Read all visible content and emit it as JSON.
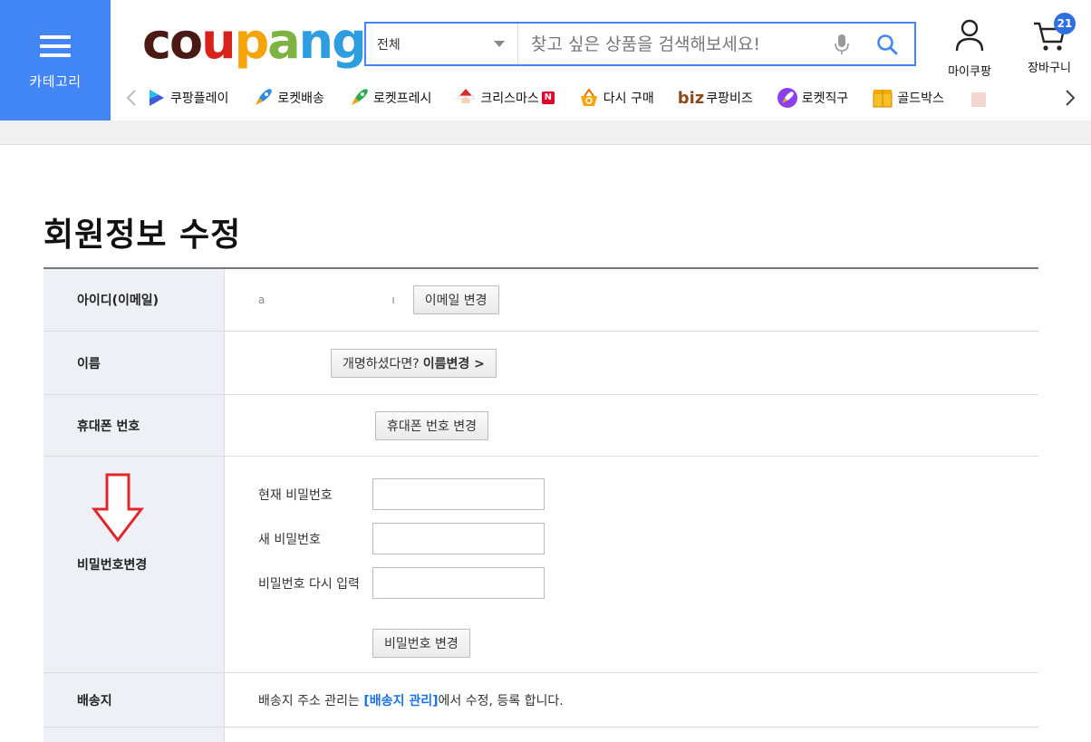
{
  "header": {
    "category_label": "카테고리",
    "search": {
      "select_value": "전체",
      "placeholder": "찾고 싶은 상품을 검색해보세요!"
    },
    "my_coupang_label": "마이쿠팡",
    "cart_label": "장바구니",
    "cart_count": "21",
    "nav_items": [
      {
        "label": "쿠팡플레이",
        "icon": "play-icon"
      },
      {
        "label": "로켓배송",
        "icon": "rocket-icon"
      },
      {
        "label": "로켓프레시",
        "icon": "rocket-fresh-icon"
      },
      {
        "label": "크리스마스",
        "icon": "santa-icon",
        "badge": "N"
      },
      {
        "label": "다시 구매",
        "icon": "basket-icon"
      },
      {
        "label": "쿠팡비즈",
        "icon": "biz-icon",
        "prefix": "biz"
      },
      {
        "label": "로켓직구",
        "icon": "rocket-global-icon"
      },
      {
        "label": "골드박스",
        "icon": "goldbox-icon"
      }
    ]
  },
  "page": {
    "title": "회원정보 수정"
  },
  "form": {
    "id_label": "아이디(이메일)",
    "id_value_start": "a",
    "id_value_end": "ı",
    "email_change_btn": "이메일 변경",
    "name_label": "이름",
    "rename_btn_text": "개명하셨다면?",
    "rename_btn_bold": "이름변경 >",
    "phone_label": "휴대폰 번호",
    "phone_change_btn": "휴대폰 번호 변경",
    "password_label": "비밀번호변경",
    "current_pw_label": "현재 비밀번호",
    "new_pw_label": "새 비밀번호",
    "confirm_pw_label": "비밀번호 다시 입력",
    "change_pw_btn": "비밀번호 변경",
    "shipping_label": "배송지",
    "shipping_text_pre": "배송지 주소 관리는",
    "shipping_link": "[배송지 관리]",
    "shipping_text_post": "에서 수정, 등록 합니다."
  },
  "colors": {
    "accent": "#4285f4",
    "label_bg": "#eef0f6",
    "arrow_red": "#e0272b",
    "link_blue": "#1a73e8"
  }
}
